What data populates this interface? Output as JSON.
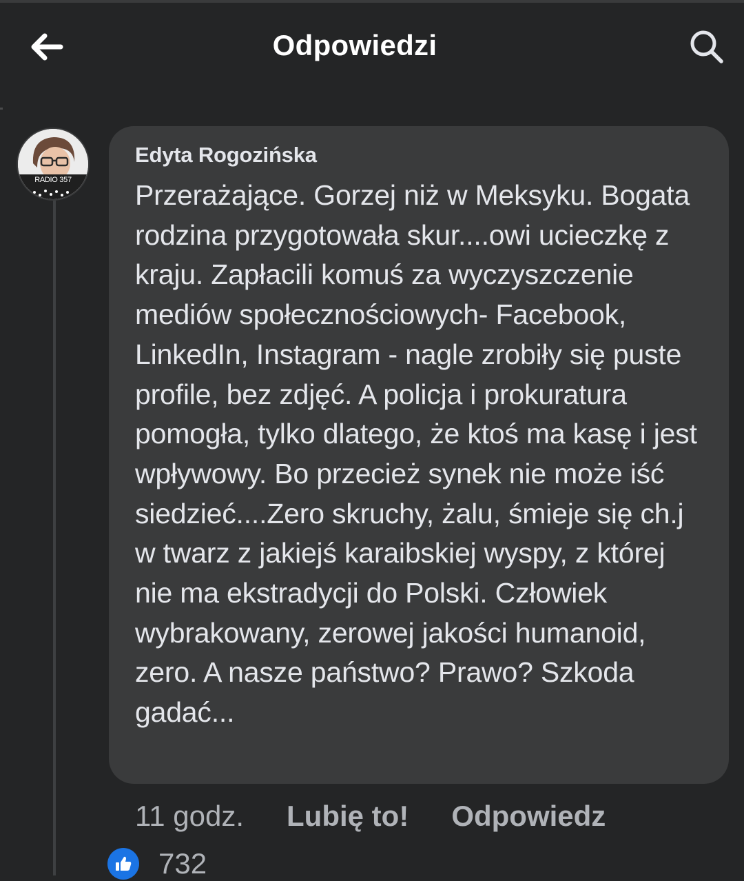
{
  "header": {
    "title": "Odpowiedzi",
    "back_icon": "arrow-left-icon",
    "search_icon": "search-icon"
  },
  "comment": {
    "author": "Edyta Rogozińska",
    "avatar_badge": "RADIO 357",
    "text": "Przerażające. Gorzej niż w Meksyku. Bogata rodzina przygotowała skur....owi ucieczkę z kraju. Zapłacili komuś za wyczyszczenie mediów społecznościowych- Facebook, LinkedIn, Instagram - nagle zrobiły się puste profile, bez zdjęć. A policja i prokuratura pomogła, tylko dlatego, że ktoś ma kasę i jest wpływowy. Bo przecież synek nie może iść siedzieć....Zero skruchy, żalu, śmieje się ch.j w twarz z jakiejś karaibskiej wyspy, z której nie ma ekstradycji do Polski. Człowiek wybrakowany, zerowej jakości humanoid, zero. A nasze państwo? Prawo? Szkoda gadać...",
    "time": "11 godz.",
    "like_label": "Lubię to!",
    "reply_label": "Odpowiedz",
    "reaction_icon": "thumbs-up-icon",
    "reaction_count": "732"
  },
  "colors": {
    "background": "#242526",
    "bubble": "#3a3b3c",
    "text": "#e4e6eb",
    "secondary_text": "#b0b3b8",
    "like_blue": "#1b74e4"
  }
}
